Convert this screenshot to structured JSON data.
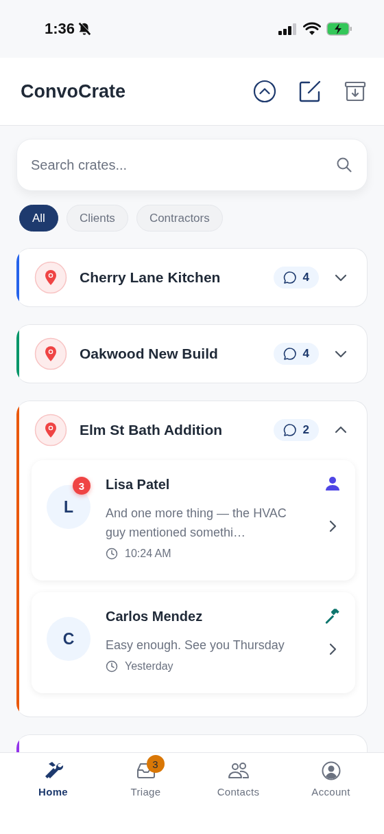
{
  "status_bar": {
    "time": "1:36"
  },
  "header": {
    "title": "ConvoCrate"
  },
  "search": {
    "placeholder": "Search crates..."
  },
  "chips": [
    {
      "label": "All",
      "selected": true
    },
    {
      "label": "Clients",
      "selected": false
    },
    {
      "label": "Contractors",
      "selected": false
    }
  ],
  "crates": [
    {
      "title": "Cherry Lane Kitchen",
      "color": "#2563eb",
      "messages": "4",
      "expanded": false
    },
    {
      "title": "Oakwood New Build",
      "color": "#059669",
      "messages": "4",
      "expanded": false
    },
    {
      "title": "Elm St Bath Addition",
      "color": "#ea580c",
      "messages": "2",
      "expanded": true,
      "contacts": [
        {
          "initial": "L",
          "name": "Lisa Patel",
          "kind": "client",
          "unread": "3",
          "preview": "And one more thing — the HVAC guy mentioned somethi…",
          "time": "10:24 AM"
        },
        {
          "initial": "C",
          "name": "Carlos Mendez",
          "kind": "contractor",
          "preview": "Easy enough. See you Thursday",
          "time": "Yesterday"
        }
      ]
    },
    {
      "color": "#9333ea"
    }
  ],
  "tab_bar": [
    {
      "kind": "home",
      "label": "Home",
      "selected": true
    },
    {
      "kind": "triage",
      "label": "Triage",
      "selected": false,
      "badge": "3"
    },
    {
      "kind": "contacts",
      "label": "Contacts",
      "selected": false
    },
    {
      "kind": "account",
      "label": "Account",
      "selected": false
    }
  ]
}
